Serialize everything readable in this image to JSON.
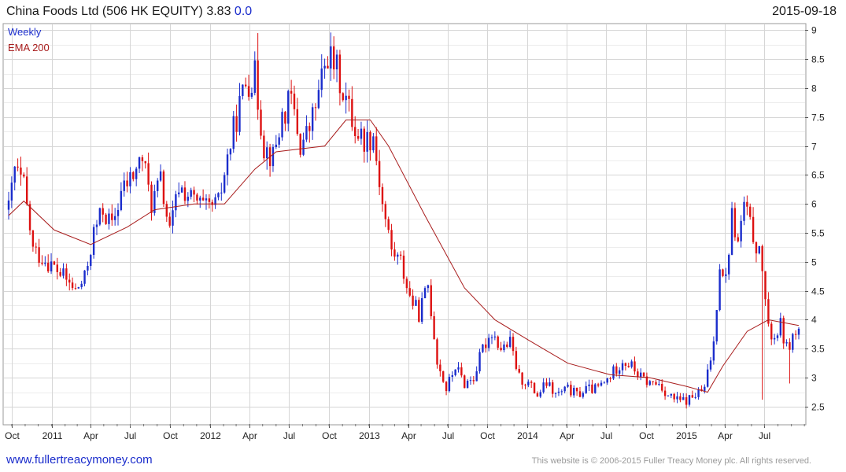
{
  "header": {
    "title_main": "China Foods Ltd (506 HK EQUITY) 3.83",
    "title_change": "0.0",
    "date": "2015-09-18"
  },
  "footer": {
    "website": "www.fullertreacymoney.com",
    "copyright": "This website is © 2006-2015 Fuller Treacy Money plc. All rights reserved."
  },
  "colors": {
    "up": "#1b2dcc",
    "down": "#dd1111",
    "ema": "#a81c1c",
    "grid": "#d6d6d6"
  },
  "chart_data": {
    "type": "candlestick",
    "legend": [
      "Weekly",
      "EMA 200"
    ],
    "legend_placement": "top-left",
    "y_axis_side": "right",
    "ylim": [
      2.2,
      9.1
    ],
    "y_ticks": [
      2.5,
      3,
      3.5,
      4,
      4.5,
      5,
      5.5,
      6,
      6.5,
      7,
      7.5,
      8,
      8.5,
      9
    ],
    "y_tick_labels": [
      "2.5",
      "3",
      "3.5",
      "4",
      "4.5",
      "5",
      "5.5",
      "6",
      "6.5",
      "7",
      "7.5",
      "8",
      "8.5",
      "9"
    ],
    "grid": true,
    "x_range": [
      "2010-09-24",
      "2015-09-18"
    ],
    "x_ticks": [
      {
        "date": "2010-10-01",
        "label": "Oct"
      },
      {
        "date": "2011-01-01",
        "label": "2011"
      },
      {
        "date": "2011-04-01",
        "label": "Apr"
      },
      {
        "date": "2011-07-01",
        "label": "Jul"
      },
      {
        "date": "2011-10-01",
        "label": "Oct"
      },
      {
        "date": "2012-01-01",
        "label": "2012"
      },
      {
        "date": "2012-04-01",
        "label": "Apr"
      },
      {
        "date": "2012-07-01",
        "label": "Jul"
      },
      {
        "date": "2012-10-01",
        "label": "Oct"
      },
      {
        "date": "2013-01-01",
        "label": "2013"
      },
      {
        "date": "2013-04-01",
        "label": "Apr"
      },
      {
        "date": "2013-07-01",
        "label": "Jul"
      },
      {
        "date": "2013-10-01",
        "label": "Oct"
      },
      {
        "date": "2014-01-01",
        "label": "2014"
      },
      {
        "date": "2014-04-01",
        "label": "Apr"
      },
      {
        "date": "2014-07-01",
        "label": "Jul"
      },
      {
        "date": "2014-10-01",
        "label": "Oct"
      },
      {
        "date": "2015-01-01",
        "label": "2015"
      },
      {
        "date": "2015-04-01",
        "label": "Apr"
      },
      {
        "date": "2015-07-01",
        "label": "Jul"
      }
    ],
    "close_anchors": [
      [
        "2010-09-24",
        5.9
      ],
      [
        "2010-10-08",
        6.6
      ],
      [
        "2010-10-29",
        6.3
      ],
      [
        "2010-11-19",
        5.2
      ],
      [
        "2010-12-24",
        5.0
      ],
      [
        "2011-01-21",
        4.8
      ],
      [
        "2011-02-25",
        4.5
      ],
      [
        "2011-03-18",
        4.7
      ],
      [
        "2011-04-08",
        5.5
      ],
      [
        "2011-04-29",
        5.9
      ],
      [
        "2011-05-20",
        5.6
      ],
      [
        "2011-06-10",
        6.2
      ],
      [
        "2011-07-08",
        6.5
      ],
      [
        "2011-07-29",
        6.8
      ],
      [
        "2011-08-19",
        6.0
      ],
      [
        "2011-09-09",
        6.4
      ],
      [
        "2011-09-30",
        5.5
      ],
      [
        "2011-10-21",
        6.3
      ],
      [
        "2011-11-18",
        6.1
      ],
      [
        "2011-12-23",
        5.9
      ],
      [
        "2012-01-20",
        6.0
      ],
      [
        "2012-02-10",
        6.8
      ],
      [
        "2012-03-02",
        7.5
      ],
      [
        "2012-03-23",
        8.1
      ],
      [
        "2012-04-13",
        8.2
      ],
      [
        "2012-05-04",
        7.0
      ],
      [
        "2012-05-25",
        6.8
      ],
      [
        "2012-06-15",
        7.5
      ],
      [
        "2012-07-06",
        7.8
      ],
      [
        "2012-07-27",
        7.0
      ],
      [
        "2012-08-17",
        7.3
      ],
      [
        "2012-09-07",
        7.9
      ],
      [
        "2012-09-28",
        8.6
      ],
      [
        "2012-10-19",
        8.3
      ],
      [
        "2012-11-09",
        7.8
      ],
      [
        "2012-11-30",
        7.3
      ],
      [
        "2012-12-21",
        7.1
      ],
      [
        "2013-01-11",
        7.2
      ],
      [
        "2013-02-01",
        6.0
      ],
      [
        "2013-02-22",
        5.2
      ],
      [
        "2013-03-15",
        5.0
      ],
      [
        "2013-04-05",
        4.4
      ],
      [
        "2013-04-26",
        4.1
      ],
      [
        "2013-05-17",
        4.6
      ],
      [
        "2013-06-07",
        3.3
      ],
      [
        "2013-06-28",
        2.8
      ],
      [
        "2013-07-19",
        3.2
      ],
      [
        "2013-08-09",
        2.9
      ],
      [
        "2013-08-30",
        3.0
      ],
      [
        "2013-09-20",
        3.5
      ],
      [
        "2013-10-11",
        3.8
      ],
      [
        "2013-11-01",
        3.5
      ],
      [
        "2013-11-22",
        3.6
      ],
      [
        "2013-12-13",
        3.0
      ],
      [
        "2014-01-03",
        2.9
      ],
      [
        "2014-01-24",
        2.7
      ],
      [
        "2014-02-14",
        2.9
      ],
      [
        "2014-03-07",
        2.7
      ],
      [
        "2014-04-04",
        2.8
      ],
      [
        "2014-04-25",
        2.7
      ],
      [
        "2014-05-16",
        2.8
      ],
      [
        "2014-06-06",
        2.8
      ],
      [
        "2014-06-27",
        2.9
      ],
      [
        "2014-07-18",
        3.1
      ],
      [
        "2014-08-08",
        3.3
      ],
      [
        "2014-08-29",
        3.2
      ],
      [
        "2014-09-19",
        3.0
      ],
      [
        "2014-10-10",
        2.9
      ],
      [
        "2014-10-31",
        2.9
      ],
      [
        "2014-11-21",
        2.7
      ],
      [
        "2014-12-12",
        2.6
      ],
      [
        "2015-01-02",
        2.6
      ],
      [
        "2015-01-23",
        2.7
      ],
      [
        "2015-02-13",
        2.8
      ],
      [
        "2015-03-06",
        3.6
      ],
      [
        "2015-03-20",
        5.0
      ],
      [
        "2015-04-03",
        4.7
      ],
      [
        "2015-04-17",
        5.8
      ],
      [
        "2015-05-01",
        5.3
      ],
      [
        "2015-05-15",
        6.0
      ],
      [
        "2015-05-29",
        5.6
      ],
      [
        "2015-06-12",
        5.3
      ],
      [
        "2015-06-26",
        4.9
      ],
      [
        "2015-07-10",
        3.8
      ],
      [
        "2015-07-24",
        3.7
      ],
      [
        "2015-08-07",
        3.9
      ],
      [
        "2015-08-21",
        3.5
      ],
      [
        "2015-09-04",
        3.7
      ],
      [
        "2015-09-18",
        3.83
      ]
    ],
    "spikes": [
      [
        "2012-04-20",
        "high",
        8.95
      ],
      [
        "2015-06-26",
        "low",
        2.62
      ],
      [
        "2015-08-28",
        "low",
        2.9
      ]
    ],
    "ema_anchors": [
      [
        "2010-09-24",
        5.8
      ],
      [
        "2010-10-29",
        6.05
      ],
      [
        "2011-01-07",
        5.55
      ],
      [
        "2011-04-01",
        5.3
      ],
      [
        "2011-06-24",
        5.6
      ],
      [
        "2011-08-26",
        5.9
      ],
      [
        "2011-11-25",
        6.0
      ],
      [
        "2012-02-03",
        6.0
      ],
      [
        "2012-04-13",
        6.6
      ],
      [
        "2012-06-01",
        6.9
      ],
      [
        "2012-07-27",
        6.95
      ],
      [
        "2012-09-21",
        7.0
      ],
      [
        "2012-11-09",
        7.45
      ],
      [
        "2013-01-04",
        7.45
      ],
      [
        "2013-02-15",
        7.0
      ],
      [
        "2013-05-10",
        5.8
      ],
      [
        "2013-08-09",
        4.55
      ],
      [
        "2013-10-18",
        4.0
      ],
      [
        "2014-01-03",
        3.65
      ],
      [
        "2014-04-04",
        3.25
      ],
      [
        "2014-07-11",
        3.05
      ],
      [
        "2014-10-10",
        3.0
      ],
      [
        "2015-01-02",
        2.85
      ],
      [
        "2015-02-20",
        2.75
      ],
      [
        "2015-03-27",
        3.2
      ],
      [
        "2015-05-22",
        3.8
      ],
      [
        "2015-07-10",
        4.0
      ],
      [
        "2015-09-18",
        3.9
      ]
    ]
  }
}
